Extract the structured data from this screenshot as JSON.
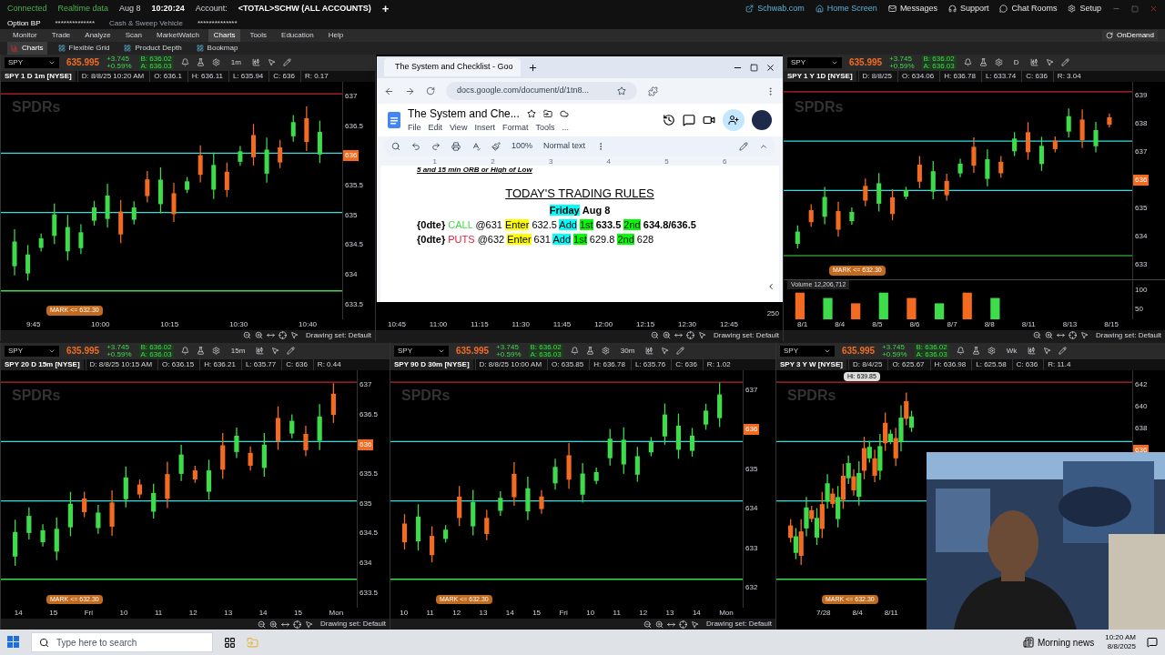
{
  "status_bar": {
    "connection": "Connected",
    "feed": "Realtime data",
    "date": "Aug 8",
    "time": "10:20:24",
    "account_label": "Account:",
    "account": "<TOTAL>SCHW (ALL ACCOUNTS)",
    "add": "+",
    "option_bp": "Option BP",
    "option_bp_value": "**************",
    "cash_label": "Cash & Sweep Vehicle",
    "cash_value": "**************"
  },
  "top_links": [
    {
      "label": "Schwab.com",
      "kind": "external"
    },
    {
      "label": "Home Screen",
      "kind": "home"
    },
    {
      "label": "Messages",
      "kind": "mail"
    },
    {
      "label": "Support",
      "kind": "support"
    },
    {
      "label": "Chat Rooms",
      "kind": "chat"
    },
    {
      "label": "Setup",
      "kind": "gear"
    }
  ],
  "menu": [
    {
      "label": "Monitor",
      "selected": false
    },
    {
      "label": "Trade",
      "selected": false
    },
    {
      "label": "Analyze",
      "selected": false
    },
    {
      "label": "Scan",
      "selected": false
    },
    {
      "label": "MarketWatch",
      "selected": false
    },
    {
      "label": "Charts",
      "selected": true
    },
    {
      "label": "Tools",
      "selected": false
    },
    {
      "label": "Education",
      "selected": false
    },
    {
      "label": "Help",
      "selected": false
    }
  ],
  "on_demand": "OnDemand",
  "subtabs": [
    {
      "label": "Charts",
      "selected": true
    },
    {
      "label": "Flexible Grid",
      "selected": false
    },
    {
      "label": "Product Depth",
      "selected": false
    },
    {
      "label": "Bookmap",
      "selected": false
    }
  ],
  "charts": [
    {
      "kind": "full",
      "symbol": "SPY",
      "price": "635.995",
      "change": "+3.745",
      "change_pct": "+0.59%",
      "bid": "B: 636.02",
      "ask": "A: 636.03",
      "timeframe": "1m",
      "title": "SPY 1 D 1m [NYSE]",
      "info": [
        "D: 8/8/25 10:20 AM",
        "O: 636.1",
        "H: 636.11",
        "L: 635.94",
        "C: 636",
        "R: 0.17"
      ],
      "watermark": "SPDRs",
      "yticks": [
        {
          "label": "637",
          "highlighted": false
        },
        {
          "label": "636.5",
          "highlighted": false
        },
        {
          "label": "636",
          "highlighted": true
        },
        {
          "label": "635.5",
          "highlighted": false
        },
        {
          "label": "635",
          "highlighted": false
        },
        {
          "label": "634.5",
          "highlighted": false
        },
        {
          "label": "634",
          "highlighted": false
        },
        {
          "label": "633.5",
          "highlighted": false
        }
      ],
      "mark": "MARK <= 632.30",
      "xticks": [
        "9:45",
        "10:00",
        "10:15",
        "10:30",
        "10:40"
      ],
      "drawing_set": "Drawing set: Default"
    },
    {
      "kind": "covered",
      "xticks": [
        "10:45",
        "11:00",
        "11:15",
        "11:30",
        "11:45",
        "12:00",
        "12:15",
        "12:30",
        "12:45"
      ],
      "axis_value": "250",
      "drawing_set": "Drawing set: Default"
    },
    {
      "kind": "full",
      "symbol": "SPY",
      "price": "635.995",
      "change": "+3.745",
      "change_pct": "+0.59%",
      "bid": "B: 636.02",
      "ask": "A: 636.03",
      "timeframe": "D",
      "title": "SPY 1 Y 1D [NYSE]",
      "info": [
        "D: 8/8/25",
        "O: 634.06",
        "H: 636.78",
        "L: 633.74",
        "C: 636",
        "R: 3.04"
      ],
      "watermark": "SPDRs",
      "yticks": [
        {
          "label": "639",
          "highlighted": false
        },
        {
          "label": "638",
          "highlighted": false
        },
        {
          "label": "637",
          "highlighted": false
        },
        {
          "label": "636",
          "highlighted": true
        },
        {
          "label": "635",
          "highlighted": false
        },
        {
          "label": "634",
          "highlighted": false
        },
        {
          "label": "633",
          "highlighted": false
        }
      ],
      "mark": "MARK <= 632.30",
      "volume": {
        "label": "Volume",
        "value": "12,206,712",
        "ticks": [
          "100",
          "50"
        ]
      },
      "xticks": [
        "8/1",
        "8/4",
        "8/5",
        "8/6",
        "8/7",
        "8/8",
        "8/11",
        "8/13",
        "8/15"
      ],
      "drawing_set": "Drawing set: Default"
    },
    {
      "kind": "full",
      "symbol": "SPY",
      "price": "635.995",
      "change": "+3.745",
      "change_pct": "+0.59%",
      "bid": "B: 636.02",
      "ask": "A: 636.03",
      "timeframe": "15m",
      "title": "SPY 20 D 15m [NYSE]",
      "info": [
        "D: 8/8/25 10:15 AM",
        "O: 636.15",
        "H: 636.21",
        "L: 635.77",
        "C: 636",
        "R: 0.44"
      ],
      "watermark": "SPDRs",
      "yticks": [
        {
          "label": "637",
          "highlighted": false
        },
        {
          "label": "636.5",
          "highlighted": false
        },
        {
          "label": "636",
          "highlighted": true
        },
        {
          "label": "635.5",
          "highlighted": false
        },
        {
          "label": "635",
          "highlighted": false
        },
        {
          "label": "634.5",
          "highlighted": false
        },
        {
          "label": "634",
          "highlighted": false
        },
        {
          "label": "633.5",
          "highlighted": false
        }
      ],
      "mark": "MARK <= 632.30",
      "xticks": [
        "14",
        "15",
        "Fri",
        "10",
        "11",
        "12",
        "13",
        "14",
        "15",
        "Mon"
      ],
      "drawing_set": "Drawing set: Default"
    },
    {
      "kind": "full",
      "symbol": "SPY",
      "price": "635.995",
      "change": "+3.745",
      "change_pct": "+0.59%",
      "bid": "B: 636.02",
      "ask": "A: 636.03",
      "timeframe": "30m",
      "title": "SPY 90 D 30m [NYSE]",
      "info": [
        "D: 8/8/25 10:00 AM",
        "O: 635.85",
        "H: 636.78",
        "L: 635.76",
        "C: 636",
        "R: 1.02"
      ],
      "watermark": "SPDRs",
      "yticks": [
        {
          "label": "637",
          "highlighted": false
        },
        {
          "label": "636",
          "highlighted": true
        },
        {
          "label": "635",
          "highlighted": false
        },
        {
          "label": "634",
          "highlighted": false
        },
        {
          "label": "633",
          "highlighted": false
        },
        {
          "label": "632",
          "highlighted": false
        }
      ],
      "mark": "MARK <= 632.30",
      "xticks": [
        "10",
        "11",
        "12",
        "13",
        "14",
        "15",
        "Fri",
        "10",
        "11",
        "12",
        "13",
        "14",
        "Mon"
      ],
      "drawing_set": "Drawing set: Default"
    },
    {
      "kind": "full",
      "symbol": "SPY",
      "price": "635.995",
      "change": "+3.745",
      "change_pct": "+0.59%",
      "bid": "B: 636.02",
      "ask": "A: 636.03",
      "timeframe": "Wk",
      "title": "SPY 3 Y W [NYSE]",
      "info": [
        "D: 8/4/25",
        "O: 625.67",
        "H: 636.98",
        "L: 625.58",
        "C: 636",
        "R: 11.4"
      ],
      "watermark": "SPDRs",
      "hi": "Hi: 639.85",
      "yticks": [
        {
          "label": "642",
          "highlighted": false
        },
        {
          "label": "640",
          "highlighted": false
        },
        {
          "label": "638",
          "highlighted": false
        },
        {
          "label": "636",
          "highlighted": true
        }
      ],
      "mark": "MARK <= 632.30",
      "xticks": [
        "7/28",
        "8/4",
        "8/11"
      ]
    }
  ],
  "browser": {
    "tab_title": "The System and Checklist - Goo",
    "url": "docs.google.com/document/d/1tn8...",
    "doc_title": "The System and Che...",
    "doc_menu": [
      "File",
      "Edit",
      "View",
      "Insert",
      "Format",
      "Tools",
      "..."
    ],
    "zoom": "100%",
    "style": "Normal text",
    "ruler": [
      "1",
      "2",
      "3",
      "4",
      "5",
      "6"
    ],
    "cut_heading": "5 and 15 min ORB or High of Low",
    "heading": "TODAY'S TRADING RULES",
    "lines": [
      [
        {
          "text": "Friday",
          "kind": "marker_bold",
          "color": "#00ffff"
        },
        {
          "text": "Aug 8",
          "kind": "bold"
        }
      ],
      [
        {
          "text": "{0dte}",
          "kind": "bold"
        },
        {
          "text": "CALL",
          "kind": "colored",
          "color": "#44dd44"
        },
        {
          "text": "@631",
          "kind": "plain"
        },
        {
          "text": "Enter",
          "kind": "marker",
          "color": "#ffff00"
        },
        {
          "text": "632.5",
          "kind": "plain"
        },
        {
          "text": "Add",
          "kind": "marker",
          "color": "#00ffff"
        },
        {
          "text": "1st",
          "kind": "marker",
          "color": "#00ff00"
        },
        {
          "text": "633.5",
          "kind": "bold"
        },
        {
          "text": "2nd",
          "kind": "marker",
          "color": "#00ff00"
        },
        {
          "text": "634.8/636.5",
          "kind": "bold"
        }
      ],
      [
        {
          "text": "{0dte}",
          "kind": "bold"
        },
        {
          "text": "PUTS",
          "kind": "colored",
          "color": "#e0203c"
        },
        {
          "text": "@632",
          "kind": "plain"
        },
        {
          "text": "Enter",
          "kind": "marker",
          "color": "#ffff00"
        },
        {
          "text": "631",
          "kind": "plain"
        },
        {
          "text": "Add",
          "kind": "marker",
          "color": "#00ffff"
        },
        {
          "text": "1st",
          "kind": "marker",
          "color": "#00ff00"
        },
        {
          "text": "629.8",
          "kind": "plain"
        },
        {
          "text": "2nd",
          "kind": "marker",
          "color": "#00ff00"
        },
        {
          "text": "628",
          "kind": "plain"
        }
      ]
    ]
  },
  "taskbar": {
    "search_placeholder": "Type here to search",
    "news": "Morning news",
    "time": "10:20 AM",
    "date": "8/8/2025"
  }
}
